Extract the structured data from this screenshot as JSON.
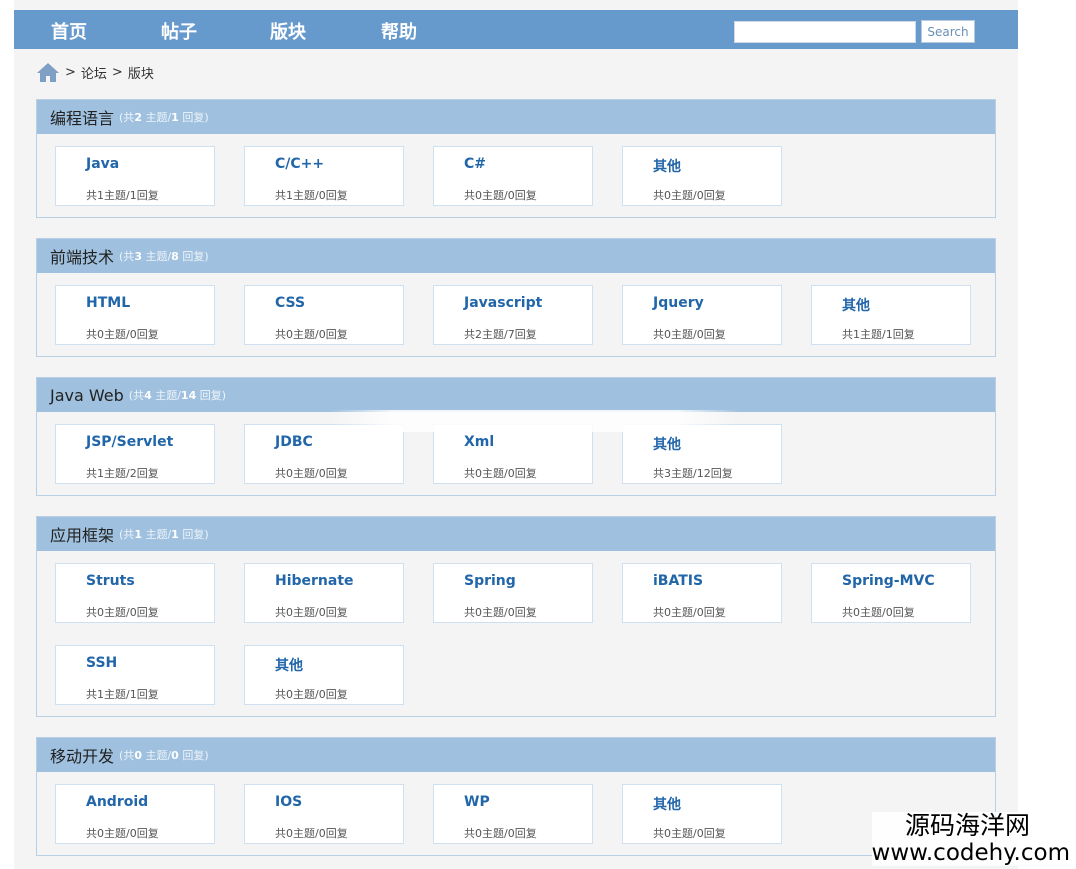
{
  "nav": {
    "items": [
      "首页",
      "帖子",
      "版块",
      "帮助"
    ],
    "search_value": "",
    "search_button": "Search"
  },
  "breadcrumb": {
    "home_icon": "home-icon",
    "items": [
      "论坛",
      "版块"
    ],
    "separator": ">"
  },
  "sections": [
    {
      "title": "编程语言",
      "stats_prefix": "(共",
      "topics": "2",
      "topics_label": " 主题/",
      "replies": "1",
      "replies_label": " 回复)",
      "boards": [
        {
          "name": "Java",
          "stats": "共1主题/1回复"
        },
        {
          "name": "C/C++",
          "stats": "共1主题/0回复"
        },
        {
          "name": "C#",
          "stats": "共0主题/0回复"
        },
        {
          "name": "其他",
          "stats": "共0主题/0回复"
        }
      ]
    },
    {
      "title": "前端技术",
      "stats_prefix": "(共",
      "topics": "3",
      "topics_label": " 主题/",
      "replies": "8",
      "replies_label": " 回复)",
      "boards": [
        {
          "name": "HTML",
          "stats": "共0主题/0回复"
        },
        {
          "name": "CSS",
          "stats": "共0主题/0回复"
        },
        {
          "name": "Javascript",
          "stats": "共2主题/7回复"
        },
        {
          "name": "Jquery",
          "stats": "共0主题/0回复"
        },
        {
          "name": "其他",
          "stats": "共1主题/1回复"
        }
      ]
    },
    {
      "title": "Java Web",
      "stats_prefix": "(共",
      "topics": "4",
      "topics_label": " 主题/",
      "replies": "14",
      "replies_label": " 回复)",
      "boards": [
        {
          "name": "JSP/Servlet",
          "stats": "共1主题/2回复"
        },
        {
          "name": "JDBC",
          "stats": "共0主题/0回复"
        },
        {
          "name": "Xml",
          "stats": "共0主题/0回复"
        },
        {
          "name": "其他",
          "stats": "共3主题/12回复"
        }
      ]
    },
    {
      "title": "应用框架",
      "stats_prefix": "(共",
      "topics": "1",
      "topics_label": " 主题/",
      "replies": "1",
      "replies_label": " 回复)",
      "boards": [
        {
          "name": "Struts",
          "stats": "共0主题/0回复"
        },
        {
          "name": "Hibernate",
          "stats": "共0主题/0回复"
        },
        {
          "name": "Spring",
          "stats": "共0主题/0回复"
        },
        {
          "name": "iBATIS",
          "stats": "共0主题/0回复"
        },
        {
          "name": "Spring-MVC",
          "stats": "共0主题/0回复"
        },
        {
          "name": "SSH",
          "stats": "共1主题/1回复"
        },
        {
          "name": "其他",
          "stats": "共0主题/0回复"
        }
      ]
    },
    {
      "title": "移动开发",
      "stats_prefix": "(共",
      "topics": "0",
      "topics_label": " 主题/",
      "replies": "0",
      "replies_label": " 回复)",
      "boards": [
        {
          "name": "Android",
          "stats": "共0主题/0回复"
        },
        {
          "name": "IOS",
          "stats": "共0主题/0回复"
        },
        {
          "name": "WP",
          "stats": "共0主题/0回复"
        },
        {
          "name": "其他",
          "stats": "共0主题/0回复"
        }
      ]
    }
  ],
  "watermark": {
    "title": "源码海洋网",
    "url": "www.codehy.com"
  },
  "colors": {
    "nav_bg": "#6699cc",
    "section_header_bg": "#9fc1df",
    "board_link": "#2266aa"
  }
}
